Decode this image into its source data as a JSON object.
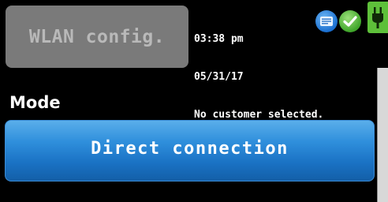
{
  "header": {
    "title": "WLAN config.",
    "time": "03:38 pm",
    "date": "05/31/17",
    "customer_status": "No customer selected."
  },
  "status_icons": [
    {
      "icon": "message-icon",
      "color": "#1a6fd0"
    },
    {
      "icon": "check-icon",
      "color": "#3fa52a"
    },
    {
      "icon": "power-plug-icon",
      "color": "#5ec03a"
    }
  ],
  "main": {
    "mode_label": "Mode",
    "mode_value": "Direct connection"
  },
  "colors": {
    "background": "#000000",
    "title_box": "#7a7a7a",
    "title_text": "#b9b9b9",
    "accent_blue": "#1a72c4"
  }
}
